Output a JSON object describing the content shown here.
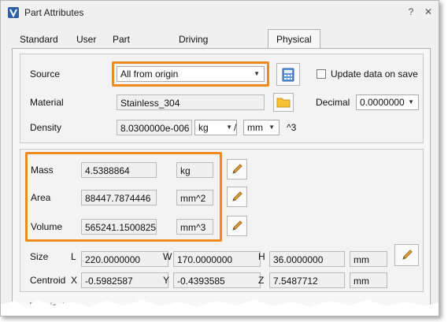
{
  "window": {
    "title": "Part Attributes",
    "help_glyph": "?",
    "close_glyph": "✕"
  },
  "tabs": [
    "Standard",
    "User",
    "Part Config",
    "Driving Parameters",
    "Physical"
  ],
  "active_tab": "Physical",
  "source": {
    "label": "Source",
    "value": "All from origin"
  },
  "update_on_save": {
    "label": "Update data on save",
    "checked": false
  },
  "material": {
    "label": "Material",
    "value": "Stainless_304"
  },
  "decimal": {
    "label": "Decimal",
    "value": "0.0000000"
  },
  "density": {
    "label": "Density",
    "value": "8.0300000e-006",
    "mass_unit": "kg",
    "separator": "/",
    "length_unit": "mm",
    "exponent": "^3"
  },
  "properties": {
    "mass": {
      "label": "Mass",
      "value": "4.5388864",
      "unit": "kg"
    },
    "area": {
      "label": "Area",
      "value": "88447.7874446",
      "unit": "mm^2"
    },
    "volume": {
      "label": "Volume",
      "value": "565241.1500825",
      "unit": "mm^3"
    }
  },
  "size": {
    "label": "Size",
    "l_label": "L",
    "l": "220.0000000",
    "w_label": "W",
    "w": "170.0000000",
    "h_label": "H",
    "h": "36.0000000",
    "unit": "mm"
  },
  "centroid": {
    "label": "Centroid",
    "x_label": "X",
    "x": "-0.5982587",
    "y_label": "Y",
    "y": "-0.4393585",
    "z_label": "Z",
    "z": "7.5487712",
    "unit": "mm"
  },
  "footer_fragment": "Physical",
  "colors": {
    "highlight": "#f08a1c",
    "pencil": "#e8a33c"
  }
}
